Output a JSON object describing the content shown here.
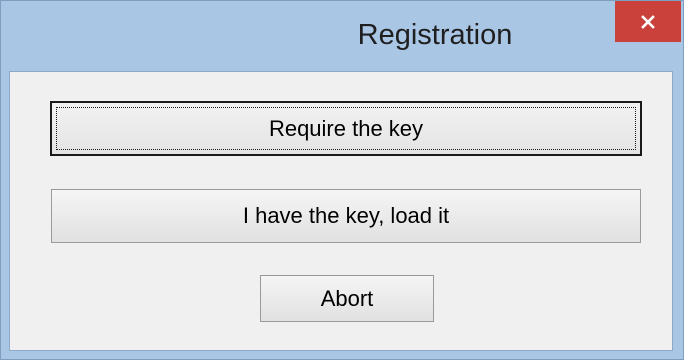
{
  "window": {
    "title": "Registration",
    "close_glyph": "×"
  },
  "buttons": {
    "require_key": "Require the key",
    "load_key": "I have the key, load it",
    "abort": "Abort"
  },
  "colors": {
    "titlebar": "#a9c6e4",
    "close_button": "#c9413a",
    "client_area": "#f0f0f0"
  },
  "icons": {
    "close": "close-icon"
  }
}
